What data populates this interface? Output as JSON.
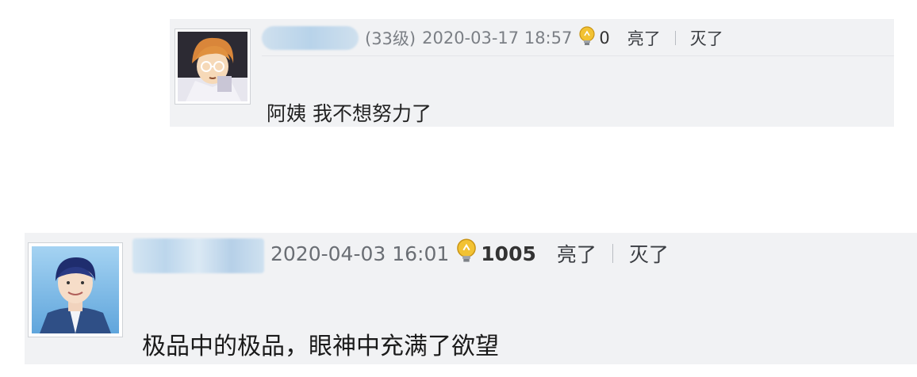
{
  "comments": [
    {
      "level": "(33级)",
      "timestamp": "2020-03-17 18:57",
      "like_count": "0",
      "like_label": "亮了",
      "dislike_label": "灭了",
      "content": "阿姨 我不想努力了",
      "username_blurred": true
    },
    {
      "timestamp": "2020-04-03 16:01",
      "like_count": "1005",
      "like_label": "亮了",
      "dislike_label": "灭了",
      "content": "极品中的极品，眼神中充满了欲望",
      "username_blurred": true
    }
  ],
  "icons": {
    "like": "lightbulb-icon"
  },
  "colors": {
    "comment_bg": "#f1f2f4",
    "meta_text": "#7b7f85",
    "bulb": "#f2c233"
  }
}
